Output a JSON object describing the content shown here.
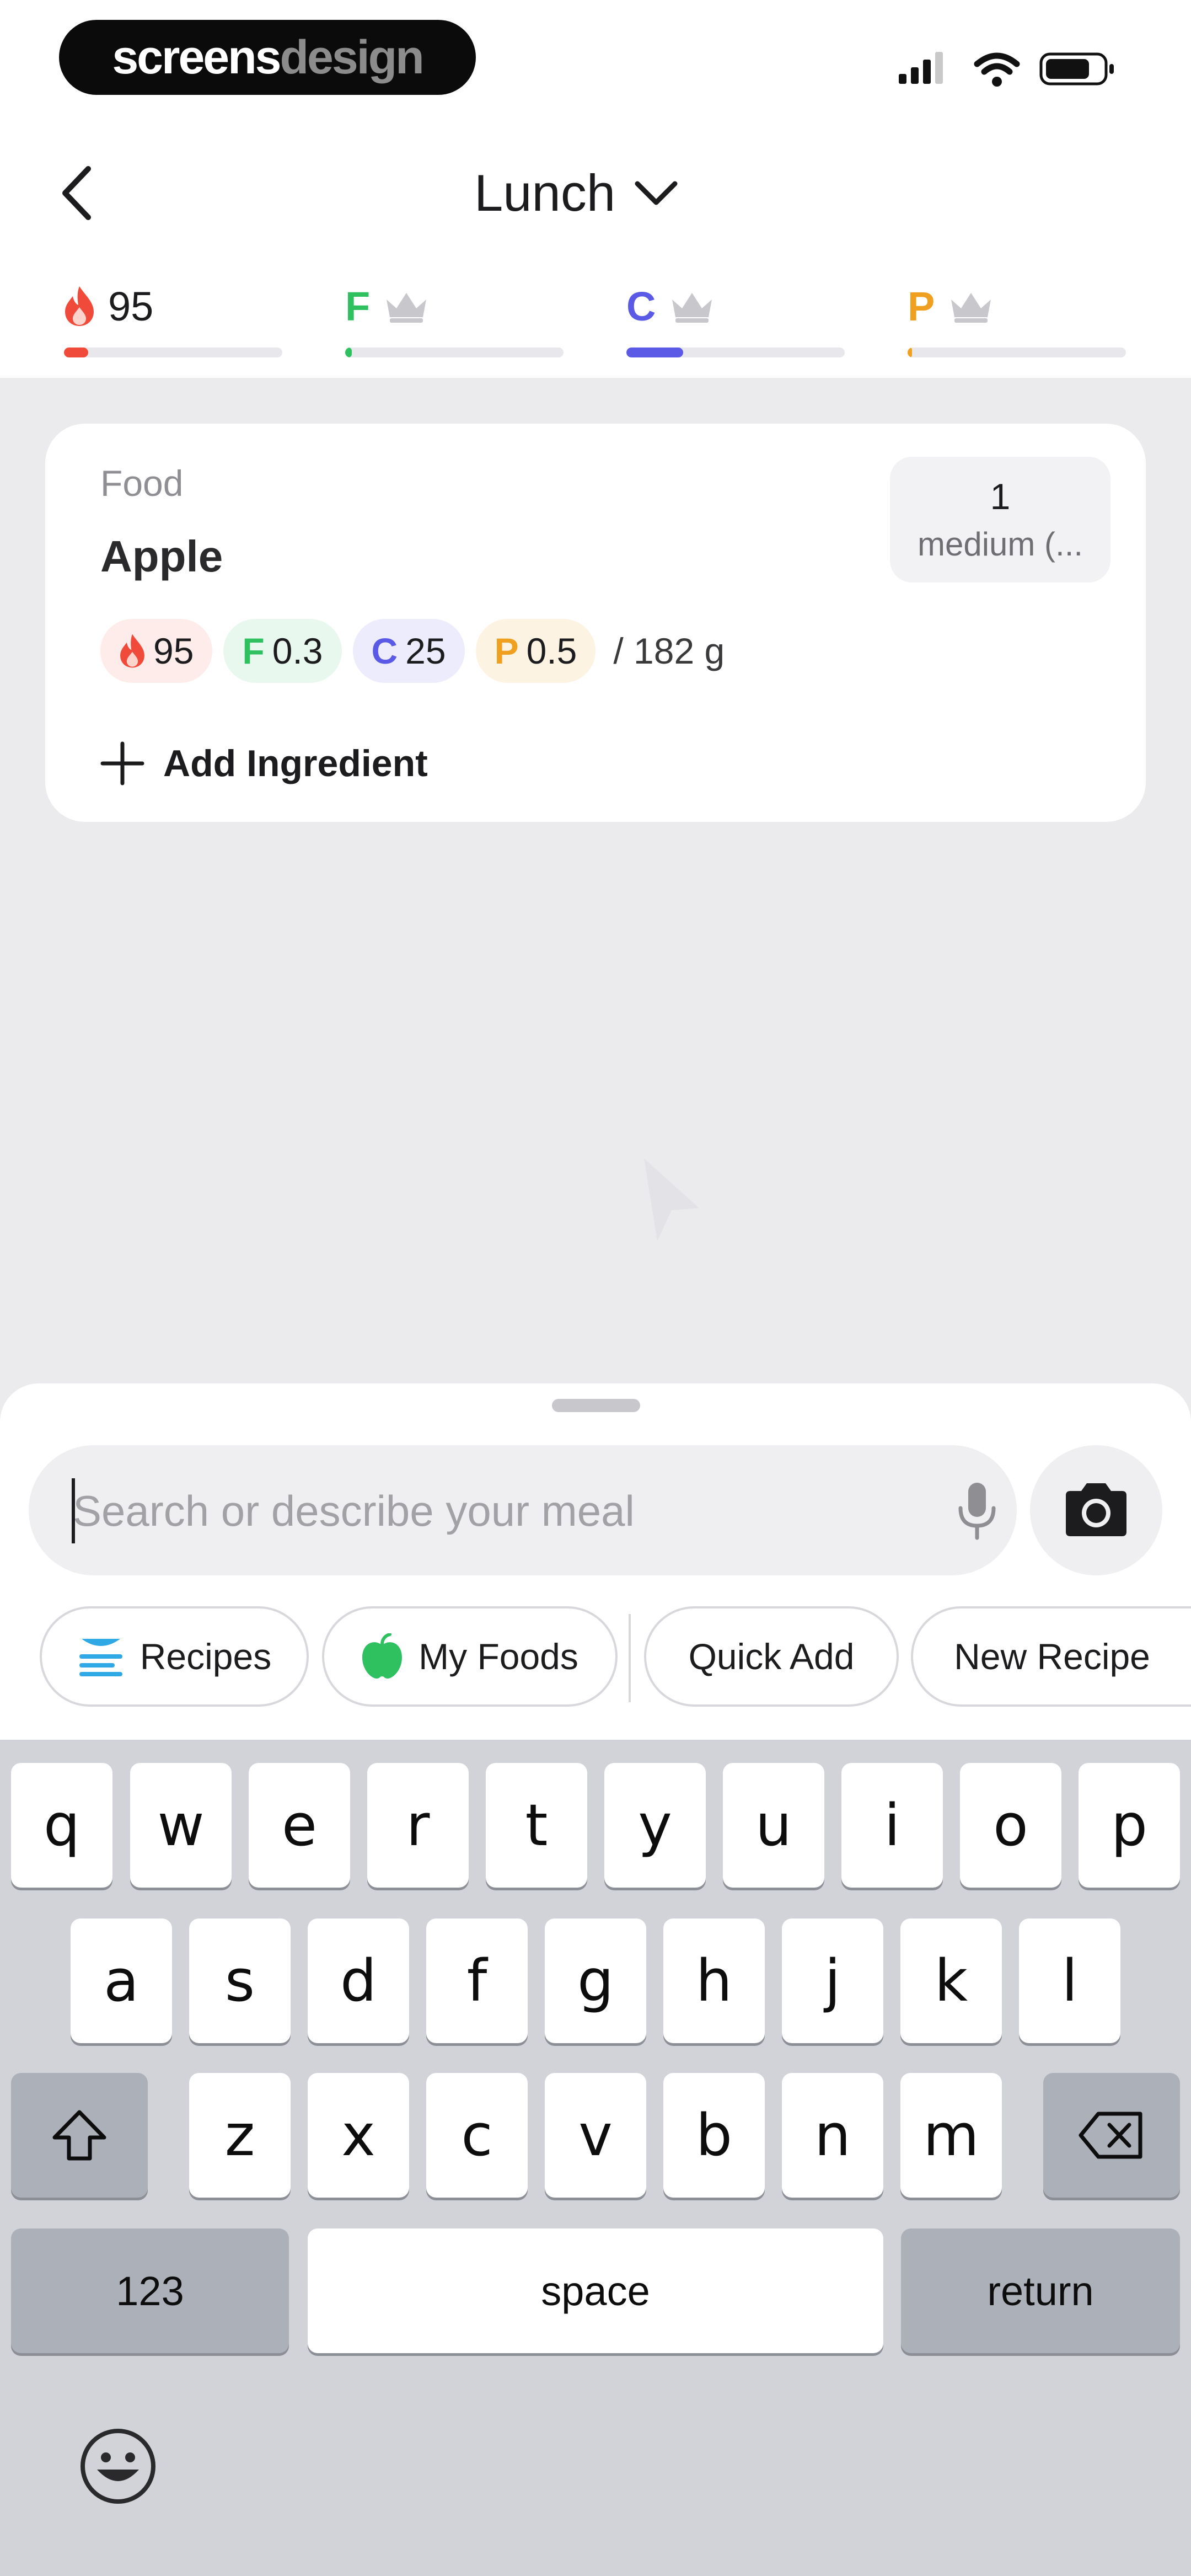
{
  "brand": {
    "part1": "screens",
    "part2": "design"
  },
  "header": {
    "title": "Lunch"
  },
  "macros_summary": [
    {
      "id": "calories",
      "letter": "",
      "value": "95",
      "color": "#f04b3a",
      "progress": 0.1
    },
    {
      "id": "fat",
      "letter": "F",
      "value": "",
      "color": "#2fc160",
      "progress": 0.03
    },
    {
      "id": "carbs",
      "letter": "C",
      "value": "",
      "color": "#5a5ae6",
      "progress": 0.26
    },
    {
      "id": "protein",
      "letter": "P",
      "value": "",
      "color": "#f0a020",
      "progress": 0.02
    }
  ],
  "food_card": {
    "type_label": "Food",
    "name": "Apple",
    "serving_qty": "1",
    "serving_unit": "medium (...",
    "calories": "95",
    "fat_letter": "F",
    "fat": "0.3",
    "carbs_letter": "C",
    "carbs": "25",
    "protein_letter": "P",
    "protein": "0.5",
    "per_weight": "/ 182 g",
    "add_ingredient": "Add Ingredient"
  },
  "search": {
    "placeholder": "Search or describe your meal",
    "value": ""
  },
  "chips": {
    "recipes": "Recipes",
    "my_foods": "My Foods",
    "quick_add": "Quick Add",
    "new_recipe": "New Recipe"
  },
  "keyboard": {
    "row1": [
      "q",
      "w",
      "e",
      "r",
      "t",
      "y",
      "u",
      "i",
      "o",
      "p"
    ],
    "row2": [
      "a",
      "s",
      "d",
      "f",
      "g",
      "h",
      "j",
      "k",
      "l"
    ],
    "row3": [
      "z",
      "x",
      "c",
      "v",
      "b",
      "n",
      "m"
    ],
    "numbers": "123",
    "space": "space",
    "return": "return"
  },
  "colors": {
    "calories": "#f04b3a",
    "fat": "#2fc160",
    "carbs": "#5a5ae6",
    "protein": "#f0a020"
  }
}
